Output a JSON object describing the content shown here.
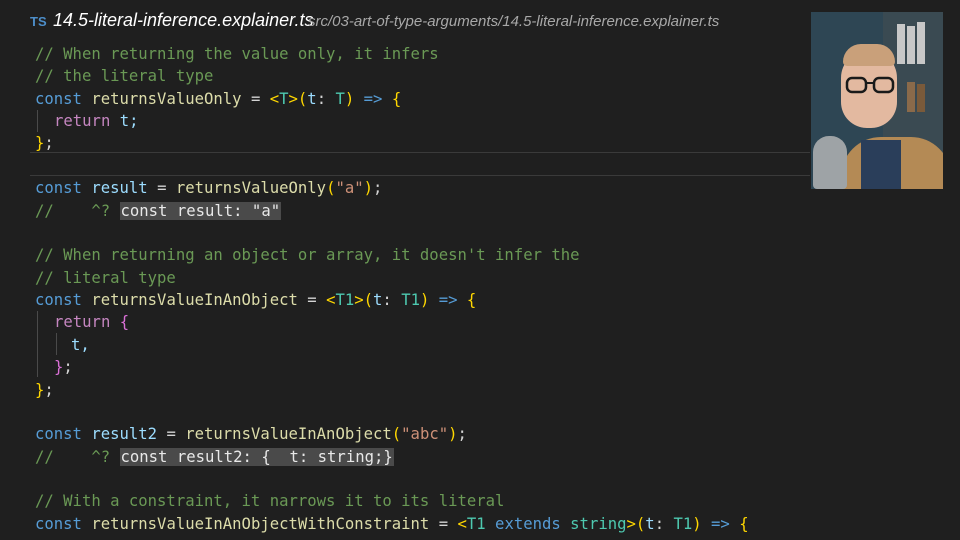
{
  "tab": {
    "icon": "TS",
    "filename": "14.5-literal-inference.explainer.ts",
    "path": "src/03-art-of-type-arguments/14.5-literal-inference.explainer.ts"
  },
  "code": {
    "l1": "// When returning the value only, it infers",
    "l2": "// the literal type",
    "l3": {
      "kw": "const",
      "name": "returnsValueOnly",
      "eq": " = ",
      "lt": "<",
      "tp": "T",
      "gt": ">",
      "op": "(",
      "param": "t",
      "colon": ": ",
      "ptype": "T",
      "cp": ")",
      "arrow": " => ",
      "ob": "{"
    },
    "l4": {
      "kw": "return",
      "val": " t;"
    },
    "l5": {
      "cb": "}",
      "semi": ";"
    },
    "l7": {
      "kw": "const",
      "name": "result",
      "eq": " = ",
      "fn": "returnsValueOnly",
      "op": "(",
      "arg": "\"a\"",
      "cp": ")",
      "semi": ";"
    },
    "l8": {
      "prefix": "//    ^? ",
      "hint": "const result: \"a\""
    },
    "l10": "// When returning an object or array, it doesn't infer the",
    "l11": "// literal type",
    "l12": {
      "kw": "const",
      "name": "returnsValueInAnObject",
      "eq": " = ",
      "lt": "<",
      "tp": "T1",
      "gt": ">",
      "op": "(",
      "param": "t",
      "colon": ": ",
      "ptype": "T1",
      "cp": ")",
      "arrow": " => ",
      "ob": "{"
    },
    "l13": {
      "kw": "return",
      "ob": " {"
    },
    "l14": {
      "val": "t,"
    },
    "l15": {
      "cb": "}",
      "semi": ";"
    },
    "l16": {
      "cb": "}",
      "semi": ";"
    },
    "l18": {
      "kw": "const",
      "name": "result2",
      "eq": " = ",
      "fn": "returnsValueInAnObject",
      "op": "(",
      "arg": "\"abc\"",
      "cp": ")",
      "semi": ";"
    },
    "l19": {
      "prefix": "//    ^? ",
      "hint": "const result2: {  t: string;}"
    },
    "l21": "// With a constraint, it narrows it to its literal",
    "l22": {
      "kw": "const",
      "name": "returnsValueInAnObjectWithConstraint",
      "eq": " = ",
      "lt": "<",
      "tp": "T1",
      "ext": " extends ",
      "ctype": "string",
      "gt": ">",
      "op": "(",
      "param": "t",
      "colon": ": ",
      "ptype": "T1",
      "cp": ")",
      "arrow": " => ",
      "ob": "{"
    }
  },
  "colors": {
    "background": "#1f1f1f",
    "comment": "#6a9955",
    "keyword": "#569cd6",
    "function": "#dcdcaa",
    "variable": "#9cdcfe",
    "type": "#4ec9b0",
    "string": "#ce9178"
  },
  "webcam": {
    "icon": "presenter-webcam"
  }
}
